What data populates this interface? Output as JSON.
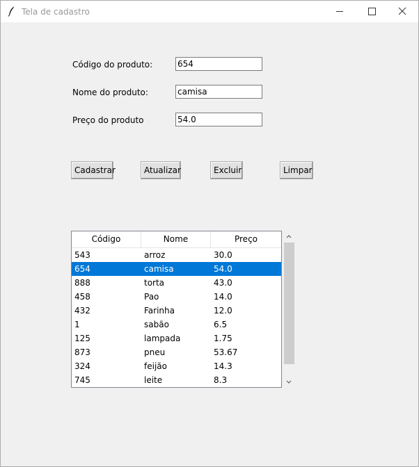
{
  "window": {
    "title": "Tela de cadastro"
  },
  "form": {
    "codigo_label": "Código do produto:",
    "codigo_value": "654",
    "nome_label": "Nome do produto:",
    "nome_value": "camisa",
    "preco_label": "Preço do produto",
    "preco_value": "54.0"
  },
  "buttons": {
    "cadastrar": "Cadastrar",
    "atualizar": "Atualizar",
    "excluir": "Excluir",
    "limpar": "Limpar"
  },
  "table": {
    "headers": [
      "Código",
      "Nome",
      "Preço"
    ],
    "selected_index": 1,
    "rows": [
      [
        "543",
        "arroz",
        "30.0"
      ],
      [
        "654",
        "camisa",
        "54.0"
      ],
      [
        "888",
        "torta",
        "43.0"
      ],
      [
        "458",
        "Pao",
        "14.0"
      ],
      [
        "432",
        "Farinha",
        "12.0"
      ],
      [
        "1",
        "sabão",
        "6.5"
      ],
      [
        "125",
        "lampada",
        "1.75"
      ],
      [
        "873",
        "pneu",
        "53.67"
      ],
      [
        "324",
        "feijão",
        "14.3"
      ],
      [
        "745",
        "leite",
        "8.3"
      ]
    ]
  },
  "icons": {
    "app": "feather-icon",
    "minimize": "minimize-icon",
    "maximize": "maximize-icon",
    "close": "close-icon",
    "scroll_up": "chevron-up-icon",
    "scroll_down": "chevron-down-icon"
  },
  "colors": {
    "selection": "#0078d7",
    "window_bg": "#f0f0f0"
  }
}
